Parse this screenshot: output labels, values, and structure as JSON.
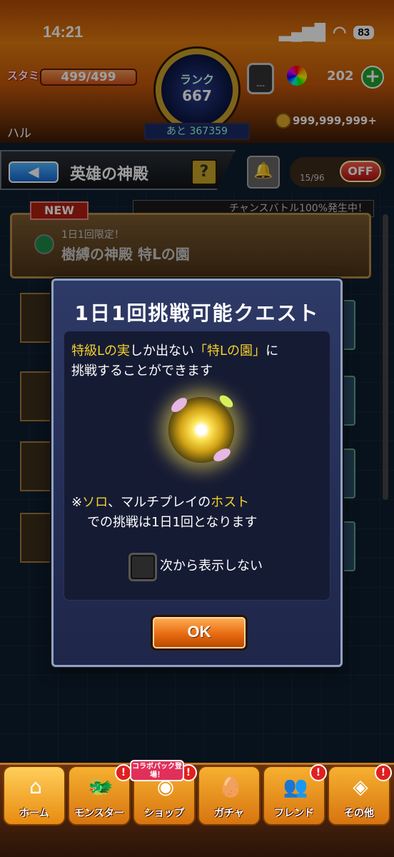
{
  "status_bar": {
    "time": "14:21",
    "battery": "83"
  },
  "hud": {
    "stamina_label": "スタミナ",
    "stamina_value": "499/499",
    "player_name": "ハル",
    "rank_label": "ランク",
    "rank_value": "667",
    "rank_next": "あと 367359",
    "hatch_label": "---",
    "orb_count": "202",
    "plus_label": "+",
    "coin_count": "999,999,999+"
  },
  "header": {
    "back_label": "◀",
    "title": "英雄の神殿",
    "help_label": "?",
    "toggle_count": "15/96",
    "off_label": "OFF"
  },
  "list": {
    "new_badge": "NEW",
    "chance_banner": "チャンスバトル100%発生中！",
    "featured_sub": "1日1回限定！",
    "featured_title": "樹縛の神殿 特Lの園"
  },
  "modal": {
    "title": "1日1回挑戦可能クエスト",
    "line1_hl1": "特級Lの実",
    "line1_mid": "しか出ない",
    "line1_hl2": "「特Lの園」",
    "line1_end": "に",
    "line2": "挑戦することができます",
    "note_prefix": "※",
    "note_hl1": "ソロ",
    "note_mid": "、マルチプレイの",
    "note_hl2": "ホスト",
    "note2": "での挑戦は1日1回となります",
    "checkbox_label": "次から表示しない",
    "ok_label": "OK"
  },
  "nav": {
    "items": [
      {
        "label": "ホーム",
        "icon": "home-icon"
      },
      {
        "label": "モンスター",
        "icon": "monster-icon"
      },
      {
        "label": "ショップ",
        "icon": "shop-icon"
      },
      {
        "label": "ガチャ",
        "icon": "gacha-icon"
      },
      {
        "label": "フレンド",
        "icon": "friend-icon"
      },
      {
        "label": "その他",
        "icon": "other-icon"
      }
    ],
    "collab_badge": "コラボパック登場！",
    "alert": "!"
  }
}
